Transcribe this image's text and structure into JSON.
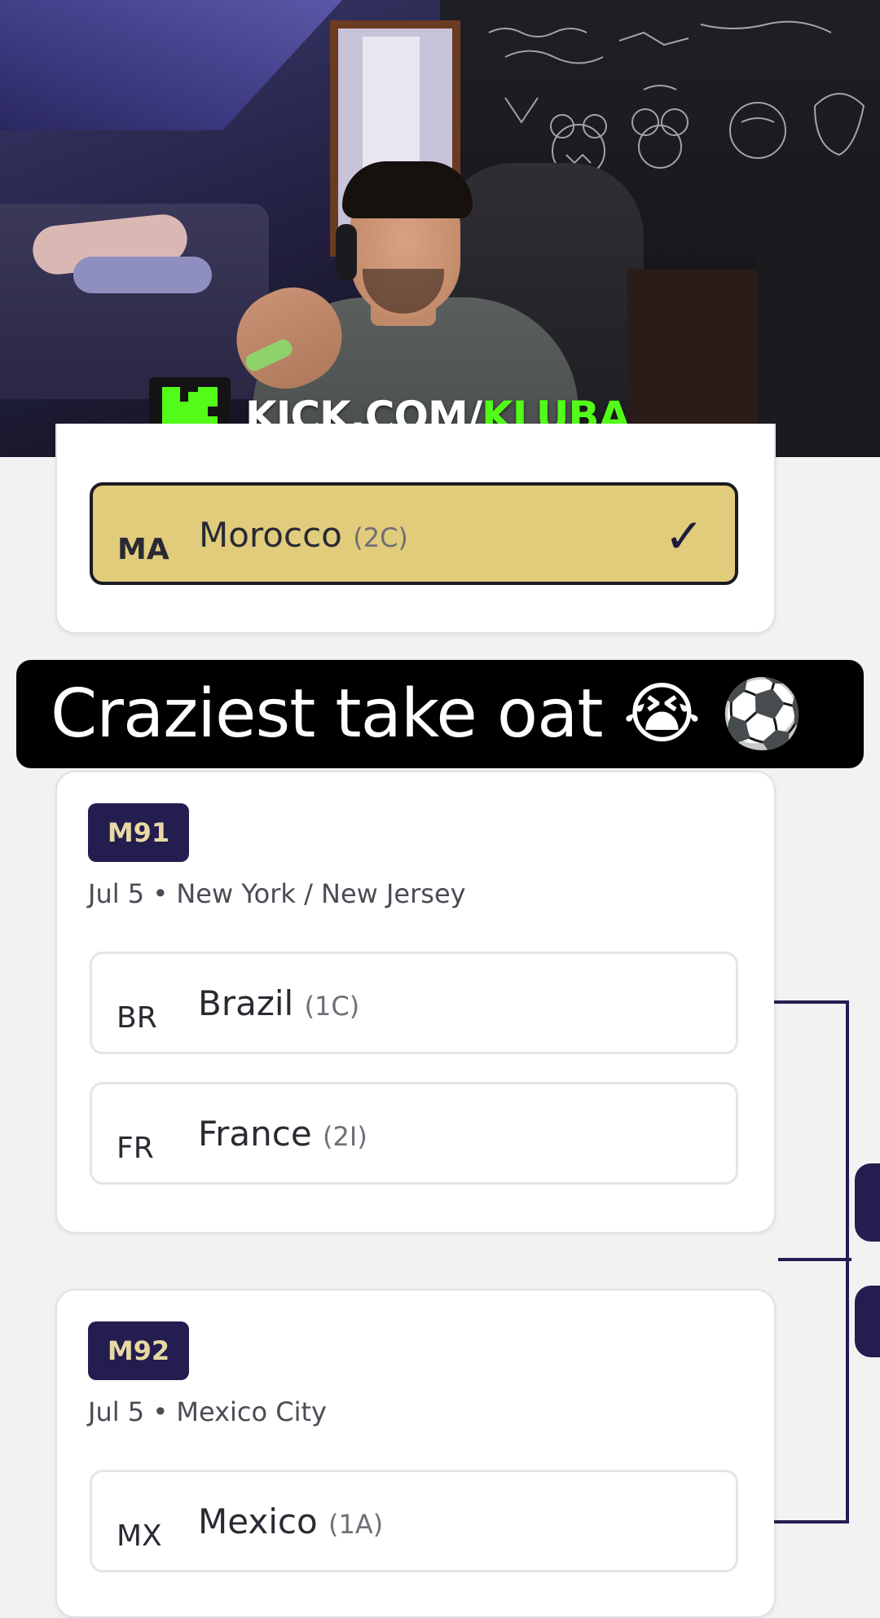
{
  "stream": {
    "url_prefix": "KICK.COM/",
    "url_channel": "KLUBA",
    "brand_color": "#53fc18"
  },
  "caption": {
    "text": "Craziest take oat 😭 ⚽️"
  },
  "bracket": {
    "top_card": {
      "team": {
        "code": "MA",
        "name": "Morocco",
        "seed": "(2C)",
        "selected": true,
        "check": "✓"
      }
    },
    "matches": [
      {
        "id": "M91",
        "meta": "Jul 5 • New York / New Jersey",
        "teams": [
          {
            "code": "BR",
            "name": "Brazil",
            "seed": "(1C)"
          },
          {
            "code": "FR",
            "name": "France",
            "seed": "(2I)"
          }
        ]
      },
      {
        "id": "M92",
        "meta": "Jul 5 • Mexico City",
        "teams": [
          {
            "code": "MX",
            "name": "Mexico",
            "seed": "(1A)"
          }
        ]
      }
    ],
    "colors": {
      "selected_bg": "#e1cc7c",
      "badge_bg": "#241d4f",
      "badge_text": "#e8d9a4"
    }
  }
}
